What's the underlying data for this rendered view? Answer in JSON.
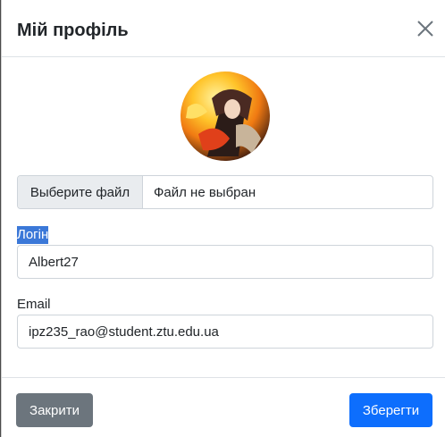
{
  "modal": {
    "title": "Мій профіль",
    "close_icon": "close-icon"
  },
  "avatar": {
    "icon": "avatar-image"
  },
  "file_input": {
    "button_label": "Выберите файл",
    "status": "Файл не выбран"
  },
  "login": {
    "label": "Логін",
    "value": "Albert27"
  },
  "email": {
    "label": "Email",
    "value": "ipz235_rao@student.ztu.edu.ua"
  },
  "footer": {
    "close_label": "Закрити",
    "save_label": "Зберегти"
  },
  "colors": {
    "primary": "#0d6efd",
    "secondary": "#6c757d",
    "selection": "#3b78d8"
  }
}
